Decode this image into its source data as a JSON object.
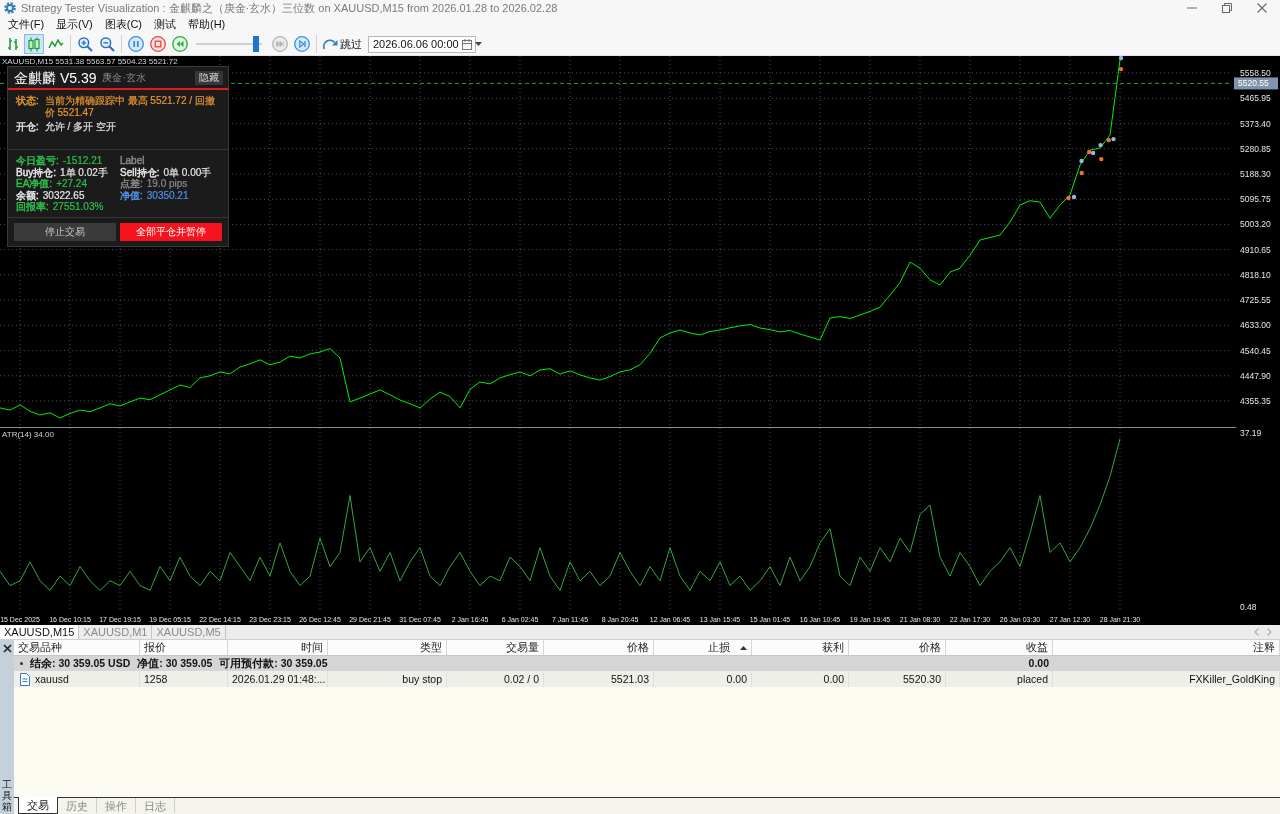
{
  "window": {
    "title": "Strategy Tester Visualization : 金麒麟之（庚金·玄水）三位数 on XAUUSD,M15 from 2026.01.28 to 2026.02.28"
  },
  "menu": [
    "文件(F)",
    "显示(V)",
    "图表(C)",
    "测试",
    "帮助(H)"
  ],
  "toolbar": {
    "chart_buttons": [
      {
        "kind": "bars",
        "selected": false
      },
      {
        "kind": "candles",
        "selected": true
      },
      {
        "kind": "line",
        "selected": false
      }
    ],
    "zoom_buttons": [
      {
        "kind": "zoom_in"
      },
      {
        "kind": "zoom_out"
      }
    ],
    "playback_buttons": [
      {
        "kind": "pause"
      },
      {
        "kind": "stop"
      },
      {
        "kind": "rewind"
      }
    ],
    "speed_slider": {
      "level": 0.95
    },
    "step_buttons": [
      {
        "kind": "skip",
        "disabled": true
      },
      {
        "kind": "step",
        "disabled": false
      }
    ],
    "skip_to": {
      "label": "跳过",
      "date": "2026.06.06 00:00"
    }
  },
  "chart": {
    "header": "XAUUSD,M15  5531.38 5563.57 5504.23 5521.72",
    "chart_data": {
      "type": "line",
      "grid": true,
      "ylim": [
        4260,
        5621
      ],
      "yticks": [
        {
          "value": 4355.35,
          "label": "4355.35"
        },
        {
          "value": 4447.9,
          "label": "4447.90"
        },
        {
          "value": 4540.45,
          "label": "4540.45"
        },
        {
          "value": 4633,
          "label": "4633.00"
        },
        {
          "value": 4725.55,
          "label": "4725.55"
        },
        {
          "value": 4818.1,
          "label": "4818.10"
        },
        {
          "value": 4910.65,
          "label": "4910.65"
        },
        {
          "value": 5003.2,
          "label": "5003.20"
        },
        {
          "value": 5095.75,
          "label": "5095.75"
        },
        {
          "value": 5188.3,
          "label": "5188.30"
        },
        {
          "value": 5280.85,
          "label": "5280.85"
        },
        {
          "value": 5373.4,
          "label": "5373.40"
        },
        {
          "value": 5465.95,
          "label": "5465.95"
        },
        {
          "value": 5558.5,
          "label": "5558.50"
        }
      ],
      "ref_lines": [
        {
          "axis": "y",
          "value": 5520.55,
          "label": "5520.55"
        }
      ],
      "series": [
        {
          "color": "#00f000",
          "values": [
            4330,
            4322,
            4341,
            4318,
            4304,
            4312,
            4293,
            4310,
            4322,
            4316,
            4330,
            4345,
            4337,
            4352,
            4366,
            4360,
            4378,
            4396,
            4414,
            4405,
            4440,
            4448,
            4462,
            4455,
            4480,
            4492,
            4506,
            4488,
            4498,
            4520,
            4513,
            4528,
            4535,
            4548,
            4513,
            4352,
            4366,
            4381,
            4396,
            4378,
            4359,
            4345,
            4330,
            4362,
            4388,
            4372,
            4330,
            4398,
            4425,
            4418,
            4440,
            4452,
            4462,
            4448,
            4469,
            4474,
            4454,
            4466,
            4451,
            4440,
            4432,
            4445,
            4462,
            4470,
            4488,
            4530,
            4587,
            4605,
            4616,
            4605,
            4598,
            4610,
            4616,
            4624,
            4631,
            4636,
            4623,
            4617,
            4609,
            4614,
            4601,
            4590,
            4579,
            4660,
            4665,
            4658,
            4671,
            4684,
            4700,
            4744,
            4790,
            4865,
            4843,
            4800,
            4781,
            4828,
            4843,
            4890,
            4946,
            4955,
            4964,
            5012,
            5074,
            5090,
            5085,
            5026,
            5074,
            5111,
            5221,
            5276,
            5283,
            5331,
            5606
          ]
        }
      ]
    }
  },
  "indicator": {
    "label": "ATR(14) 34.00",
    "chart_data": {
      "type": "line",
      "grid": true,
      "ylim": [
        -0.58,
        38.24
      ],
      "yticks": [
        {
          "value": 37.19,
          "label": "37.19"
        },
        {
          "value": 0.48,
          "label": "0.48"
        }
      ],
      "categories": [
        null,
        null,
        "15 Dec 2025",
        null,
        null,
        null,
        null,
        "16 Dec 10:15",
        null,
        null,
        null,
        null,
        "17 Dec 19:15",
        null,
        null,
        null,
        null,
        "19 Dec 05:15",
        null,
        null,
        null,
        null,
        "22 Dec 14:15",
        null,
        null,
        null,
        null,
        "23 Dec 23:15",
        null,
        null,
        null,
        null,
        "26 Dec 12:45",
        null,
        null,
        null,
        null,
        "29 Dec 21:45",
        null,
        null,
        null,
        null,
        "31 Dec 07:45",
        null,
        null,
        null,
        null,
        "2 Jan 16:45",
        null,
        null,
        null,
        null,
        "6 Jan 02:45",
        null,
        null,
        null,
        null,
        "7 Jan 11:45",
        null,
        null,
        null,
        null,
        "8 Jan 20:45",
        null,
        null,
        null,
        null,
        "12 Jan 06:45",
        null,
        null,
        null,
        null,
        "13 Jan 15:45",
        null,
        null,
        null,
        null,
        "15 Jan 01:45",
        null,
        null,
        null,
        null,
        "16 Jan 10:45",
        null,
        null,
        null,
        null,
        "19 Jan 19:45",
        null,
        null,
        null,
        null,
        "21 Jan 08:30",
        null,
        null,
        null,
        null,
        "22 Jan 17:30",
        null,
        null,
        null,
        null,
        "26 Jan 03:30",
        null,
        null,
        null,
        null,
        "27 Jan 12:30",
        null,
        null,
        null,
        null,
        "28 Jan 21:30"
      ],
      "series": [
        {
          "color": "#34a83e",
          "values": [
            8,
            5,
            6,
            10,
            6,
            4,
            7,
            5,
            9,
            6,
            4,
            6,
            5,
            8,
            5,
            4,
            9,
            6,
            11,
            7,
            5,
            8,
            6,
            12,
            9,
            6,
            11,
            7,
            14,
            8,
            5,
            7,
            15,
            9,
            12,
            24,
            10,
            13,
            8,
            12,
            6,
            10,
            13,
            7,
            5,
            9,
            12,
            8,
            5,
            7,
            6,
            11,
            9,
            6,
            13,
            7,
            4,
            10,
            6,
            8,
            5,
            7,
            12,
            8,
            5,
            9,
            6,
            13,
            7,
            4,
            8,
            6,
            10,
            5,
            7,
            4,
            6,
            9,
            5,
            11,
            6,
            9,
            14,
            17,
            7,
            5,
            11,
            8,
            13,
            10,
            15,
            12,
            20,
            22,
            11,
            7,
            12,
            9,
            5,
            8,
            10,
            13,
            9,
            16,
            24,
            12,
            14,
            10,
            13,
            17,
            22,
            28,
            36
          ]
        }
      ]
    }
  },
  "ea_panel": {
    "title": "金麒麟 V5.39",
    "subtitle": "庚金·玄水",
    "hide_button": "隐藏",
    "status_lines": [
      {
        "label": "状态:",
        "value": "当前为精确跟踪中 最高 5521.72 / 回撤价 5521.47",
        "color": "#e8962e"
      },
      {
        "label": "开仓:",
        "value": "允许 / 多开 空开",
        "color": "#e0e0e0"
      }
    ],
    "stats": [
      {
        "label": "今日盈亏:",
        "value": "-1512.21",
        "color": "#2fbf4a"
      },
      {
        "label": "Label",
        "color": "#8a8a8a"
      },
      {
        "label": "Buy持仓:",
        "value": "1单  0.02手",
        "color": "#e6e6e6"
      },
      {
        "label": "Sell持仓:",
        "value": "0单  0.00手",
        "color": "#e6e6e6"
      },
      {
        "label": "EA净值:",
        "value": "+27.24",
        "color": "#2fbf4a"
      },
      {
        "label": "点差:",
        "value": "19.0 pips",
        "color": "#8a8a8a"
      },
      {
        "label": "余额:",
        "value": "30322.65",
        "color": "#e6e6e6"
      },
      {
        "label": "净值:",
        "value": "30350.21",
        "color": "#4f8fe8"
      },
      {
        "label": "回报率:",
        "value": "27551.03%",
        "color": "#2fbf4a"
      }
    ],
    "buttons": [
      {
        "label": "停止交易",
        "kind": "secondary"
      },
      {
        "label": "全部平仓并暂停",
        "kind": "danger"
      }
    ]
  },
  "chart_tabs": [
    {
      "label": "XAUUSD,M15",
      "selected": true
    },
    {
      "label": "XAUUSD,M1",
      "selected": false
    },
    {
      "label": "XAUUSD,M5",
      "selected": false
    }
  ],
  "trade_table": {
    "columns": [
      {
        "label": "交易品种",
        "sorted": false
      },
      {
        "label": "报价",
        "sorted": false
      },
      {
        "label": "时间",
        "sorted": false
      },
      {
        "label": "类型",
        "sorted": false
      },
      {
        "label": "交易量",
        "sorted": false
      },
      {
        "label": "价格",
        "sorted": false
      },
      {
        "label": "止损",
        "sorted": true
      },
      {
        "label": "获利",
        "sorted": false
      },
      {
        "label": "价格",
        "sorted": false
      },
      {
        "label": "收益",
        "sorted": false
      },
      {
        "label": "注释",
        "sorted": false
      }
    ],
    "summary": {
      "parts": [
        "结余: 30 359.05 USD",
        "净值: 30 359.05",
        "可用预付款: 30 359.05"
      ],
      "profit": "0.00"
    },
    "rows": [
      {
        "cells": [
          "xauusd",
          "1258",
          "2026.01.29 01:48:...",
          "buy stop",
          "0.02 / 0",
          "5521.03",
          "0.00",
          "0.00",
          "5520.30",
          "placed",
          "FXKiller_GoldKing"
        ]
      }
    ]
  },
  "toolbox_label": "工具箱",
  "terminal_tabs": [
    {
      "label": "交易",
      "selected": true
    },
    {
      "label": "历史",
      "selected": false
    },
    {
      "label": "操作",
      "selected": false
    },
    {
      "label": "日志",
      "selected": false
    }
  ]
}
